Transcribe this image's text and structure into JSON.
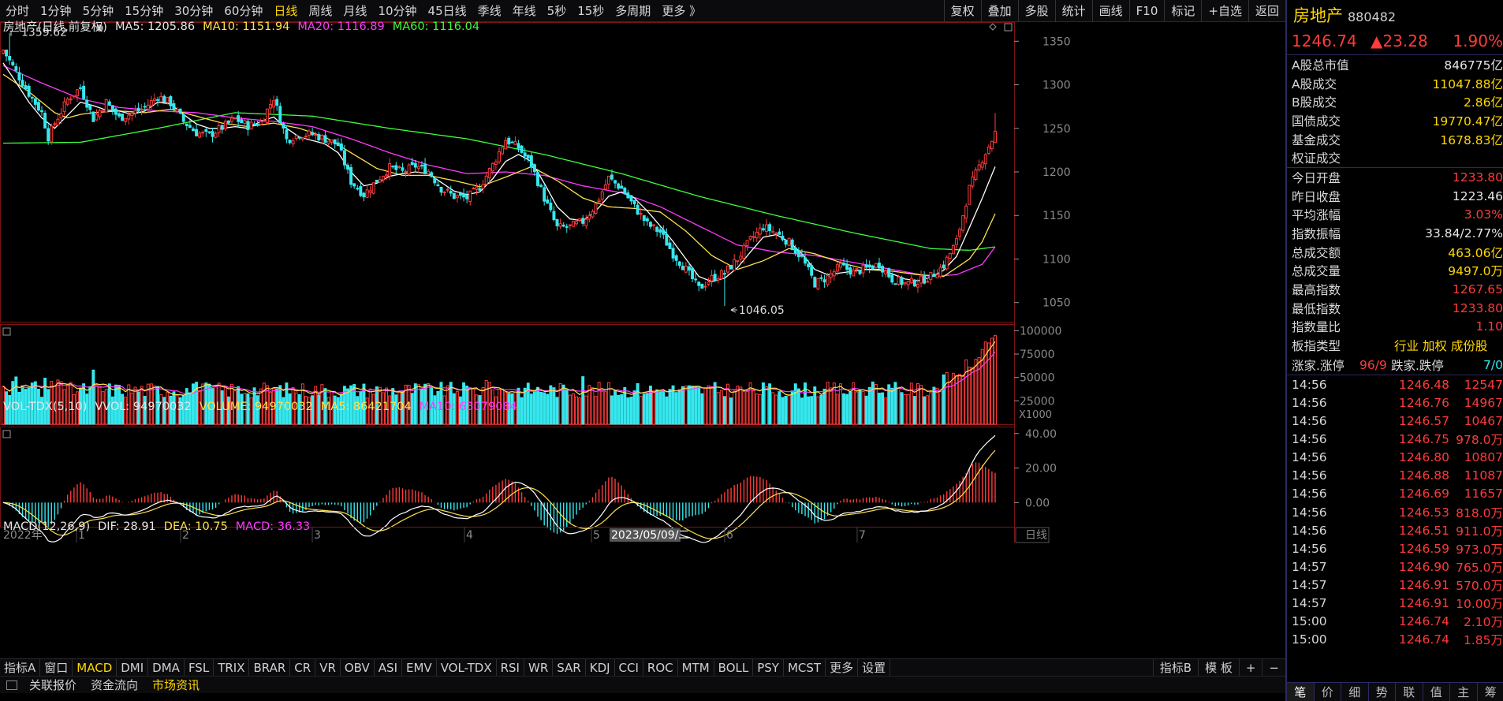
{
  "toolbar": {
    "periods": [
      "分时",
      "1分钟",
      "5分钟",
      "15分钟",
      "30分钟",
      "60分钟",
      "日线",
      "周线",
      "月线",
      "10分钟",
      "45日线",
      "季线",
      "年线",
      "5秒",
      "15秒",
      "多周期",
      "更多 》"
    ],
    "active_period": "日线",
    "tools": [
      "复权",
      "叠加",
      "多股",
      "统计",
      "画线",
      "F10",
      "标记",
      "+自选",
      "返回"
    ]
  },
  "legend": {
    "main": {
      "title": "房地产(日线,前复权)",
      "ma5": "MA5: 1205.86",
      "ma10": "MA10: 1151.94",
      "ma20": "MA20: 1116.89",
      "ma60": "MA60: 1116.04"
    },
    "vol": {
      "title": "VOL-TDX(5,10)",
      "vvol": "VVOL: 94970032",
      "volume": "VOLUME: 94970032",
      "ma5": "MA5: 86421704",
      "ma10": "MA10: 63079084"
    },
    "macd": {
      "title": "MACD(12,26,9)",
      "dif": "DIF: 28.91",
      "dea": "DEA: 10.75",
      "macd": "MACD: 36.33"
    }
  },
  "colors": {
    "up": "#ff3b3b",
    "down": "#35e8ee",
    "ma5": "#ffffff",
    "ma10": "#ffe14d",
    "ma20": "#ff3bff",
    "ma60": "#3dff3d",
    "bg": "#000000",
    "grid": "#7a1515"
  },
  "chart_data": [
    {
      "type": "candlestick",
      "title": "房地产(日线,前复权)",
      "y_ticks": [
        1350,
        1300,
        1250,
        1200,
        1150,
        1100,
        1050
      ],
      "ylim": [
        1028,
        1372
      ],
      "annotations": {
        "high": "1359.62",
        "low": "1046.05"
      },
      "x_tick_labels": [
        "2022年",
        "1",
        "2",
        "3",
        "4",
        "5",
        "2023/05/09/二",
        "6",
        "7",
        "日线"
      ],
      "close_path": [
        [
          0,
          1340
        ],
        [
          4,
          1315
        ],
        [
          8,
          1290
        ],
        [
          12,
          1268
        ],
        [
          14,
          1240
        ],
        [
          16,
          1256
        ],
        [
          20,
          1283
        ],
        [
          24,
          1297
        ],
        [
          28,
          1261
        ],
        [
          32,
          1280
        ],
        [
          36,
          1262
        ],
        [
          40,
          1267
        ],
        [
          44,
          1274
        ],
        [
          48,
          1287
        ],
        [
          52,
          1279
        ],
        [
          56,
          1258
        ],
        [
          60,
          1245
        ],
        [
          64,
          1242
        ],
        [
          68,
          1251
        ],
        [
          72,
          1261
        ],
        [
          76,
          1253
        ],
        [
          80,
          1257
        ],
        [
          84,
          1285
        ],
        [
          88,
          1237
        ],
        [
          92,
          1243
        ],
        [
          96,
          1243
        ],
        [
          100,
          1238
        ],
        [
          104,
          1231
        ],
        [
          108,
          1189
        ],
        [
          112,
          1174
        ],
        [
          116,
          1190
        ],
        [
          120,
          1205
        ],
        [
          124,
          1200
        ],
        [
          128,
          1207
        ],
        [
          132,
          1201
        ],
        [
          136,
          1181
        ],
        [
          140,
          1172
        ],
        [
          144,
          1170
        ],
        [
          148,
          1183
        ],
        [
          152,
          1208
        ],
        [
          156,
          1237
        ],
        [
          160,
          1228
        ],
        [
          164,
          1208
        ],
        [
          168,
          1170
        ],
        [
          172,
          1136
        ],
        [
          176,
          1137
        ],
        [
          180,
          1143
        ],
        [
          184,
          1162
        ],
        [
          188,
          1193
        ],
        [
          192,
          1181
        ],
        [
          196,
          1160
        ],
        [
          200,
          1140
        ],
        [
          204,
          1131
        ],
        [
          208,
          1106
        ],
        [
          212,
          1088
        ],
        [
          216,
          1066
        ],
        [
          220,
          1078
        ],
        [
          224,
          1084
        ],
        [
          228,
          1100
        ],
        [
          232,
          1122
        ],
        [
          236,
          1137
        ],
        [
          240,
          1130
        ],
        [
          244,
          1119
        ],
        [
          248,
          1101
        ],
        [
          252,
          1072
        ],
        [
          256,
          1079
        ],
        [
          260,
          1092
        ],
        [
          264,
          1085
        ],
        [
          268,
          1089
        ],
        [
          272,
          1094
        ],
        [
          276,
          1077
        ],
        [
          280,
          1072
        ],
        [
          284,
          1074
        ],
        [
          288,
          1080
        ],
        [
          292,
          1093
        ],
        [
          296,
          1120
        ],
        [
          300,
          1181
        ],
        [
          304,
          1215
        ],
        [
          308,
          1244
        ]
      ],
      "ma5_path": [
        [
          0,
          1325
        ],
        [
          4,
          1303
        ],
        [
          8,
          1280
        ],
        [
          12,
          1262
        ],
        [
          16,
          1250
        ],
        [
          20,
          1265
        ],
        [
          24,
          1280
        ],
        [
          28,
          1276
        ],
        [
          32,
          1271
        ],
        [
          36,
          1270
        ],
        [
          40,
          1266
        ],
        [
          44,
          1270
        ],
        [
          48,
          1280
        ],
        [
          52,
          1278
        ],
        [
          56,
          1266
        ],
        [
          60,
          1255
        ],
        [
          64,
          1250
        ],
        [
          68,
          1250
        ],
        [
          72,
          1252
        ],
        [
          76,
          1250
        ],
        [
          80,
          1258
        ],
        [
          84,
          1263
        ],
        [
          88,
          1250
        ],
        [
          92,
          1240
        ],
        [
          96,
          1236
        ],
        [
          100,
          1232
        ],
        [
          104,
          1222
        ],
        [
          108,
          1200
        ],
        [
          112,
          1184
        ],
        [
          116,
          1187
        ],
        [
          120,
          1195
        ],
        [
          124,
          1198
        ],
        [
          128,
          1200
        ],
        [
          132,
          1198
        ],
        [
          136,
          1188
        ],
        [
          140,
          1178
        ],
        [
          144,
          1174
        ],
        [
          148,
          1177
        ],
        [
          152,
          1192
        ],
        [
          156,
          1212
        ],
        [
          160,
          1220
        ],
        [
          164,
          1212
        ],
        [
          168,
          1187
        ],
        [
          172,
          1160
        ],
        [
          176,
          1146
        ],
        [
          180,
          1144
        ],
        [
          184,
          1155
        ],
        [
          188,
          1172
        ],
        [
          192,
          1177
        ],
        [
          196,
          1170
        ],
        [
          200,
          1155
        ],
        [
          204,
          1138
        ],
        [
          208,
          1120
        ],
        [
          212,
          1100
        ],
        [
          216,
          1080
        ],
        [
          220,
          1074
        ],
        [
          224,
          1078
        ],
        [
          228,
          1090
        ],
        [
          232,
          1108
        ],
        [
          236,
          1125
        ],
        [
          240,
          1128
        ],
        [
          244,
          1120
        ],
        [
          248,
          1106
        ],
        [
          252,
          1088
        ],
        [
          256,
          1082
        ],
        [
          260,
          1084
        ],
        [
          264,
          1086
        ],
        [
          268,
          1088
        ],
        [
          272,
          1088
        ],
        [
          276,
          1083
        ],
        [
          280,
          1077
        ],
        [
          284,
          1075
        ],
        [
          288,
          1079
        ],
        [
          292,
          1087
        ],
        [
          296,
          1103
        ],
        [
          300,
          1136
        ],
        [
          304,
          1170
        ],
        [
          308,
          1206
        ]
      ],
      "ma10_path": [
        [
          0,
          1312
        ],
        [
          8,
          1292
        ],
        [
          16,
          1268
        ],
        [
          20,
          1262
        ],
        [
          24,
          1266
        ],
        [
          28,
          1268
        ],
        [
          36,
          1270
        ],
        [
          44,
          1268
        ],
        [
          52,
          1272
        ],
        [
          60,
          1264
        ],
        [
          68,
          1256
        ],
        [
          76,
          1252
        ],
        [
          84,
          1256
        ],
        [
          92,
          1250
        ],
        [
          100,
          1240
        ],
        [
          108,
          1222
        ],
        [
          116,
          1204
        ],
        [
          124,
          1196
        ],
        [
          132,
          1196
        ],
        [
          140,
          1190
        ],
        [
          148,
          1183
        ],
        [
          156,
          1194
        ],
        [
          164,
          1206
        ],
        [
          172,
          1190
        ],
        [
          180,
          1170
        ],
        [
          188,
          1160
        ],
        [
          196,
          1158
        ],
        [
          204,
          1154
        ],
        [
          212,
          1132
        ],
        [
          220,
          1104
        ],
        [
          228,
          1088
        ],
        [
          236,
          1098
        ],
        [
          244,
          1112
        ],
        [
          252,
          1106
        ],
        [
          260,
          1096
        ],
        [
          268,
          1088
        ],
        [
          276,
          1086
        ],
        [
          284,
          1082
        ],
        [
          292,
          1080
        ],
        [
          300,
          1100
        ],
        [
          304,
          1120
        ],
        [
          308,
          1152
        ]
      ],
      "ma20_path": [
        [
          0,
          1322
        ],
        [
          12,
          1302
        ],
        [
          24,
          1284
        ],
        [
          36,
          1274
        ],
        [
          48,
          1270
        ],
        [
          60,
          1268
        ],
        [
          72,
          1262
        ],
        [
          84,
          1258
        ],
        [
          96,
          1252
        ],
        [
          108,
          1238
        ],
        [
          120,
          1222
        ],
        [
          132,
          1208
        ],
        [
          144,
          1198
        ],
        [
          156,
          1200
        ],
        [
          168,
          1196
        ],
        [
          180,
          1184
        ],
        [
          192,
          1176
        ],
        [
          204,
          1160
        ],
        [
          216,
          1138
        ],
        [
          228,
          1116
        ],
        [
          240,
          1108
        ],
        [
          252,
          1104
        ],
        [
          264,
          1096
        ],
        [
          276,
          1088
        ],
        [
          288,
          1080
        ],
        [
          296,
          1082
        ],
        [
          304,
          1094
        ],
        [
          308,
          1114
        ]
      ],
      "ma60_path": [
        [
          0,
          1233
        ],
        [
          24,
          1234
        ],
        [
          48,
          1250
        ],
        [
          72,
          1268
        ],
        [
          96,
          1264
        ],
        [
          120,
          1250
        ],
        [
          144,
          1238
        ],
        [
          168,
          1220
        ],
        [
          192,
          1198
        ],
        [
          216,
          1172
        ],
        [
          240,
          1150
        ],
        [
          264,
          1130
        ],
        [
          288,
          1112
        ],
        [
          300,
          1110
        ],
        [
          308,
          1114
        ]
      ]
    },
    {
      "type": "bar",
      "title": "VOL-TDX(5,10)",
      "y_ticks": [
        100000,
        75000,
        50000,
        25000
      ],
      "unit": "X1000",
      "ylim": [
        0,
        102000
      ],
      "last_volume": 94970032
    },
    {
      "type": "bar",
      "title": "MACD(12,26,9)",
      "y_ticks": [
        "40.00",
        "20.00",
        "0.00"
      ],
      "ylim": [
        -14,
        44
      ]
    }
  ],
  "indicator_tabs": [
    "指标A",
    "窗口",
    "MACD",
    "DMI",
    "DMA",
    "FSL",
    "TRIX",
    "BRAR",
    "CR",
    "VR",
    "OBV",
    "ASI",
    "EMV",
    "VOL-TDX",
    "RSI",
    "WR",
    "SAR",
    "KDJ",
    "CCI",
    "ROC",
    "MTM",
    "BOLL",
    "PSY",
    "MCST",
    "更多",
    "设置"
  ],
  "indicator_active": "MACD",
  "indicator_right": [
    "指标B",
    "模 板",
    "+",
    "−"
  ],
  "bottom_tabs": [
    "关联报价",
    "资金流向",
    "市场资讯"
  ],
  "bottom_active": "市场资讯",
  "panel": {
    "name": "房地产",
    "code": "880482",
    "price": "1246.74",
    "change": "▲23.28",
    "pct": "1.90%",
    "rows_a": [
      {
        "k": "A股总市值",
        "v": "846775亿",
        "c": "white"
      },
      {
        "k": "A股成交",
        "v": "11047.88亿",
        "c": "yellow"
      },
      {
        "k": "B股成交",
        "v": "2.86亿",
        "c": "yellow"
      },
      {
        "k": "国债成交",
        "v": "19770.47亿",
        "c": "yellow"
      },
      {
        "k": "基金成交",
        "v": "1678.83亿",
        "c": "yellow"
      },
      {
        "k": "权证成交",
        "v": "",
        "c": "yellow"
      }
    ],
    "rows_b": [
      {
        "k": "今日开盘",
        "v": "1233.80",
        "c": "red"
      },
      {
        "k": "昨日收盘",
        "v": "1223.46",
        "c": "white"
      },
      {
        "k": "平均涨幅",
        "v": "3.03%",
        "c": "red"
      },
      {
        "k": "指数振幅",
        "v": "33.84/2.77%",
        "c": "white"
      },
      {
        "k": "总成交额",
        "v": "463.06亿",
        "c": "yellow"
      },
      {
        "k": "总成交量",
        "v": "9497.0万",
        "c": "yellow"
      },
      {
        "k": "最高指数",
        "v": "1267.65",
        "c": "red"
      },
      {
        "k": "最低指数",
        "v": "1233.80",
        "c": "red"
      },
      {
        "k": "指数量比",
        "v": "1.10",
        "c": "red"
      }
    ],
    "type_label": "板指类型",
    "type_value": "行业 加权 成份股",
    "breadth": {
      "k1": "涨家.涨停",
      "v1": "96/9",
      "k2": "跌家.跌停",
      "v2": "7/0"
    },
    "trades": [
      {
        "t": "14:56",
        "p": "1246.48",
        "v": "12547"
      },
      {
        "t": "14:56",
        "p": "1246.76",
        "v": "14967"
      },
      {
        "t": "14:56",
        "p": "1246.57",
        "v": "10467"
      },
      {
        "t": "14:56",
        "p": "1246.75",
        "v": "978.0万"
      },
      {
        "t": "14:56",
        "p": "1246.80",
        "v": "10807"
      },
      {
        "t": "14:56",
        "p": "1246.88",
        "v": "11087"
      },
      {
        "t": "14:56",
        "p": "1246.69",
        "v": "11657"
      },
      {
        "t": "14:56",
        "p": "1246.53",
        "v": "818.0万"
      },
      {
        "t": "14:56",
        "p": "1246.51",
        "v": "911.0万"
      },
      {
        "t": "14:56",
        "p": "1246.59",
        "v": "973.0万"
      },
      {
        "t": "14:57",
        "p": "1246.90",
        "v": "765.0万"
      },
      {
        "t": "14:57",
        "p": "1246.91",
        "v": "570.0万"
      },
      {
        "t": "14:57",
        "p": "1246.91",
        "v": "10.00万"
      },
      {
        "t": "15:00",
        "p": "1246.74",
        "v": "2.10万"
      },
      {
        "t": "15:00",
        "p": "1246.74",
        "v": "1.85万"
      }
    ],
    "tabs": [
      "笔",
      "价",
      "细",
      "势",
      "联",
      "值",
      "主",
      "筹"
    ]
  }
}
